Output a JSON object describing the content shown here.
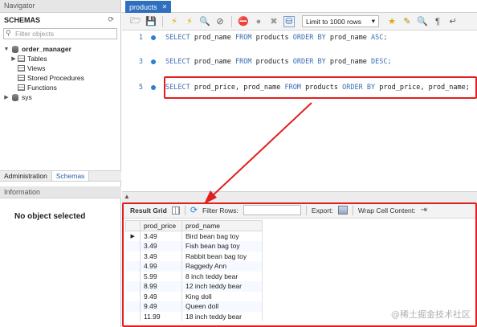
{
  "navigator": {
    "header": "Navigator",
    "schemas_title": "SCHEMAS",
    "filter_placeholder": "Filter objects",
    "tree": [
      {
        "label": "order_manager",
        "level": 0,
        "expanded": true,
        "bold": true,
        "icon": "database-icon"
      },
      {
        "label": "Tables",
        "level": 1,
        "icon": "table-icon"
      },
      {
        "label": "Views",
        "level": 1,
        "icon": "table-icon"
      },
      {
        "label": "Stored Procedures",
        "level": 1,
        "icon": "table-icon"
      },
      {
        "label": "Functions",
        "level": 1,
        "icon": "table-icon"
      },
      {
        "label": "sys",
        "level": 0,
        "expanded": false,
        "icon": "database-icon"
      }
    ],
    "tabs": [
      "Administration",
      "Schemas"
    ],
    "active_tab": "Schemas",
    "info_header": "Information",
    "no_object": "No object selected"
  },
  "editor": {
    "tab_label": "products",
    "limit_label": "Limit to 1000 rows",
    "lines": [
      {
        "num": "1",
        "sql": "SELECT prod_name FROM products ORDER BY prod_name ASC;"
      },
      {
        "num": "3",
        "sql": "SELECT prod_name FROM products ORDER BY prod_name DESC;"
      },
      {
        "num": "5",
        "sql": "SELECT prod_price, prod_name FROM products ORDER BY prod_price, prod_name;"
      }
    ]
  },
  "results": {
    "result_grid_label": "Result Grid",
    "filter_rows_label": "Filter Rows:",
    "export_label": "Export:",
    "wrap_label": "Wrap Cell Content:",
    "columns": [
      "prod_price",
      "prod_name"
    ],
    "rows": [
      [
        "3.49",
        "Bird bean bag toy"
      ],
      [
        "3.49",
        "Fish bean bag toy"
      ],
      [
        "3.49",
        "Rabbit bean bag toy"
      ],
      [
        "4.99",
        "Raggedy Ann"
      ],
      [
        "5.99",
        "8 inch teddy bear"
      ],
      [
        "8.99",
        "12 inch teddy bear"
      ],
      [
        "9.49",
        "King doll"
      ],
      [
        "9.49",
        "Queen doll"
      ],
      [
        "11.99",
        "18 inch teddy bear"
      ]
    ]
  },
  "watermark": "@稀土掘金技术社区",
  "colors": {
    "highlight": "#e02020",
    "keyword": "#3a6fb5",
    "tab": "#2f6fbf"
  }
}
